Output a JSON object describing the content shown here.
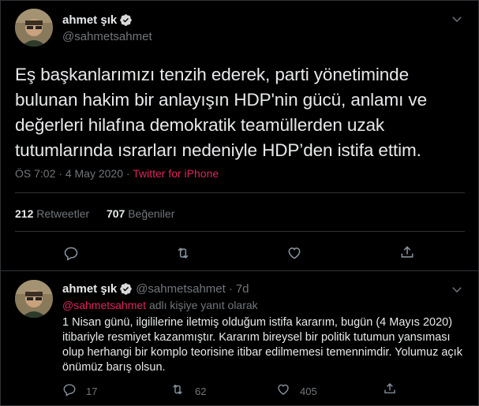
{
  "tweet": {
    "author_name": "ahmet şık",
    "author_handle": "@sahmetsahmet",
    "text": "Eş başkanlarımızı tenzih ederek, parti yönetiminde bulunan hakim bir anlayışın HDP'nin gücü, anlamı ve değerleri hilafına demokratik teamüllerden uzak tutumlarında ısrarları nedeniyle HDP’den istifa ettim.",
    "time": "ÖS 7:02",
    "date": "4 May 2020",
    "separator": "·",
    "source": "Twitter for iPhone",
    "retweets_count": "212",
    "retweets_label": "Retweetler",
    "likes_count": "707",
    "likes_label": "Beğeniler"
  },
  "reply": {
    "author_name": "ahmet şık",
    "author_handle": "@sahmetsahmet",
    "separator": "·",
    "age": "7d",
    "reply_to_mention": "@sahmetsahmet",
    "reply_to_suffix": "adlı kişiye yanıt olarak",
    "text": "1 Nisan günü, ilgililerine iletmiş olduğum istifa kararım, bugün (4 Mayıs 2020) itibariyle resmiyet kazanmıştır. Kararım bireysel bir politik tutumun yansıması olup herhangi bir komplo teorisine itibar edilmemesi temennimdir. Yolumuz açık önümüz barış olsun.",
    "replies_count": "17",
    "retweets_count": "62",
    "likes_count": "405"
  },
  "icons": {
    "verified": "verified-badge-icon",
    "chevron": "chevron-down-icon",
    "reply": "reply-icon",
    "retweet": "retweet-icon",
    "like": "heart-icon",
    "share": "share-icon"
  },
  "colors": {
    "background": "#000000",
    "text": "#e7e9ea",
    "secondary": "#71767b",
    "accent": "#e0245e",
    "verified": "#d9d9d9",
    "divider": "#2f3336"
  }
}
